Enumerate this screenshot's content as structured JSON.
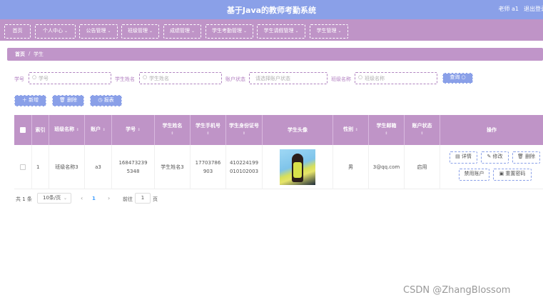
{
  "header": {
    "title": "基于Java的教师考勤系统",
    "user": "老师 a1",
    "logout": "退出登录"
  },
  "nav": [
    {
      "label": "首页",
      "chev": ""
    },
    {
      "label": "个人中心",
      "chev": "⌄"
    },
    {
      "label": "公告管理",
      "chev": "⌄"
    },
    {
      "label": "班级管理",
      "chev": "⌄"
    },
    {
      "label": "成绩管理",
      "chev": "⌄"
    },
    {
      "label": "学生考勤管理",
      "chev": "⌄"
    },
    {
      "label": "学生请假管理",
      "chev": "⌄"
    },
    {
      "label": "学生管理",
      "chev": "⌄"
    }
  ],
  "breadcrumb": {
    "home": "首页",
    "sep": "/",
    "current": "学生"
  },
  "search": {
    "fields": [
      {
        "label": "学号",
        "placeholder": "学号"
      },
      {
        "label": "学生姓名",
        "placeholder": "学生姓名"
      },
      {
        "label": "账户状态",
        "placeholder": "请选择账户状态"
      },
      {
        "label": "班级名称",
        "placeholder": "班级名称"
      }
    ],
    "button": "查询 ○"
  },
  "actions": {
    "add": "＋ 新增",
    "delete": "🗑 删除",
    "report": "◷ 报表"
  },
  "table": {
    "headers": [
      "",
      "索引",
      "班级名称",
      "账户",
      "学号",
      "学生姓名",
      "学生手机号",
      "学生身份证号",
      "学生头像",
      "性别",
      "学生邮箱",
      "账户状态",
      "操作"
    ],
    "sort_mark": "⇕",
    "row": {
      "index": "1",
      "class_name": "班级名称3",
      "account": "a3",
      "student_no": "1684732395348",
      "student_name": "学生姓名3",
      "phone": "17703786903",
      "id_card": "410224199010102003",
      "gender": "男",
      "email": "3@qq.com",
      "status": "启用"
    },
    "row_buttons": {
      "detail": "▤ 详情",
      "edit": "✎ 修改",
      "delete": "🗑 删除",
      "disable": "禁用账户",
      "reset": "▣ 重置密码"
    }
  },
  "pager": {
    "total": "共 1 条",
    "page_size": "10条/页",
    "prev": "‹",
    "current": "1",
    "next": "›",
    "goto_label": "前往",
    "goto_value": "1",
    "page_unit": "页"
  },
  "watermark": "CSDN @ZhangBlossom",
  "colors": {
    "nav": "#bf94c7",
    "accent": "#8aa0e8"
  }
}
